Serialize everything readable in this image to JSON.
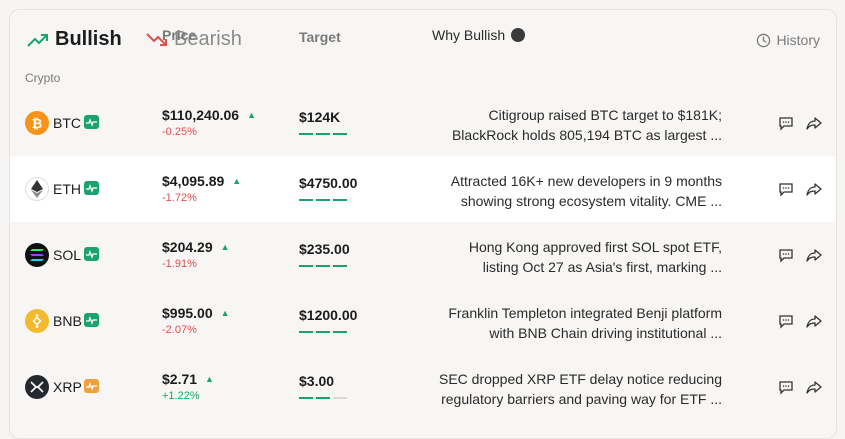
{
  "tabs": {
    "bullish": "Bullish",
    "bearish": "Bearish",
    "history": "History"
  },
  "columns": {
    "crypto": "Crypto",
    "price": "Price",
    "target": "Target",
    "why": "Why Bullish"
  },
  "colors": {
    "up": "#1aa36f",
    "down": "#e04e4e",
    "btc": "#f7931a",
    "eth": "#ffffff",
    "sol": "#111111",
    "bnb": "#f3ba2f",
    "xrp": "#23292f",
    "badge_green": "#1aa36f",
    "badge_orange": "#f2a03d"
  },
  "rows": [
    {
      "symbol": "BTC",
      "icon": "bitcoin-icon",
      "badge": "green-trend-badge",
      "price": "$110,240.06",
      "change": "-0.25%",
      "change_direction": "negative",
      "target": "$124K",
      "target_progress": "3 of 3",
      "why_line1": "Citigroup raised BTC target to $181K;",
      "why_line2": "BlackRock holds 805,194 BTC as largest ..."
    },
    {
      "symbol": "ETH",
      "icon": "ethereum-icon",
      "badge": "green-trend-badge",
      "price": "$4,095.89",
      "change": "-1.72%",
      "change_direction": "negative",
      "target": "$4750.00",
      "target_progress": "3 of 3",
      "why_line1": "Attracted 16K+ new developers in 9 months",
      "why_line2": "showing strong ecosystem vitality. CME ..."
    },
    {
      "symbol": "SOL",
      "icon": "solana-icon",
      "badge": "green-trend-badge",
      "price": "$204.29",
      "change": "-1.91%",
      "change_direction": "negative",
      "target": "$235.00",
      "target_progress": "3 of 3",
      "why_line1": "Hong Kong approved first SOL spot ETF,",
      "why_line2": "listing Oct 27 as Asia's first, marking ..."
    },
    {
      "symbol": "BNB",
      "icon": "bnb-icon",
      "badge": "green-trend-badge",
      "price": "$995.00",
      "change": "-2.07%",
      "change_direction": "negative",
      "target": "$1200.00",
      "target_progress": "3 of 3",
      "why_line1": "Franklin Templeton integrated Benji platform",
      "why_line2": "with BNB Chain driving institutional ..."
    },
    {
      "symbol": "XRP",
      "icon": "xrp-icon",
      "badge": "orange-trend-badge",
      "price": "$2.71",
      "change": "+1.22%",
      "change_direction": "positive",
      "target": "$3.00",
      "target_progress": "2 of 3",
      "why_line1": "SEC dropped XRP ETF delay notice reducing",
      "why_line2": "regulatory barriers and paving way for ETF ..."
    }
  ]
}
